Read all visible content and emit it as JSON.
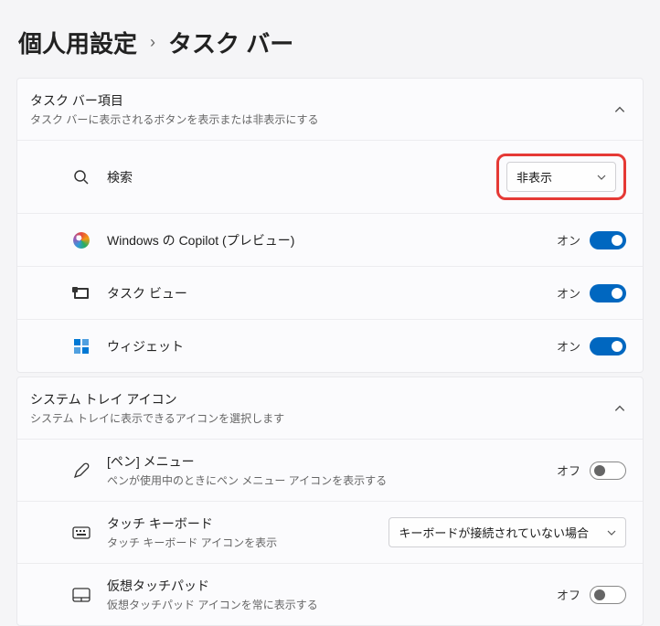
{
  "breadcrumb": {
    "parent": "個人用設定",
    "current": "タスク バー"
  },
  "section1": {
    "title": "タスク バー項目",
    "subtitle": "タスク バーに表示されるボタンを表示または非表示にする",
    "items": [
      {
        "label": "検索",
        "dropdown_value": "非表示"
      },
      {
        "label": "Windows の Copilot (プレビュー)",
        "state": "オン",
        "toggle": "on"
      },
      {
        "label": "タスク ビュー",
        "state": "オン",
        "toggle": "on"
      },
      {
        "label": "ウィジェット",
        "state": "オン",
        "toggle": "on"
      }
    ]
  },
  "section2": {
    "title": "システム トレイ アイコン",
    "subtitle": "システム トレイに表示できるアイコンを選択します",
    "items": [
      {
        "label": "[ペン] メニュー",
        "sub": "ペンが使用中のときにペン メニュー アイコンを表示する",
        "state": "オフ",
        "toggle": "off"
      },
      {
        "label": "タッチ キーボード",
        "sub": "タッチ キーボード アイコンを表示",
        "dropdown_value": "キーボードが接続されていない場合"
      },
      {
        "label": "仮想タッチパッド",
        "sub": "仮想タッチパッド アイコンを常に表示する",
        "state": "オフ",
        "toggle": "off"
      }
    ]
  }
}
